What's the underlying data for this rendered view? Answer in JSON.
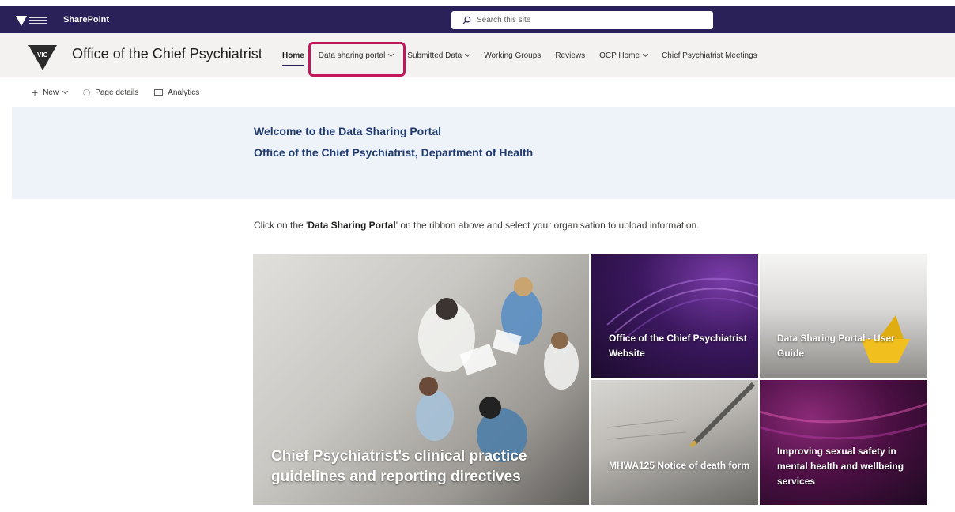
{
  "suite": {
    "app_name": "SharePoint",
    "search_placeholder": "Search this site"
  },
  "site": {
    "title": "Office of the Chief Psychiatrist"
  },
  "nav": [
    {
      "label": "Home",
      "dropdown": false
    },
    {
      "label": "Data sharing portal",
      "dropdown": true
    },
    {
      "label": "Submitted Data",
      "dropdown": true
    },
    {
      "label": "Working Groups",
      "dropdown": false
    },
    {
      "label": "Reviews",
      "dropdown": false
    },
    {
      "label": "OCP Home",
      "dropdown": true
    },
    {
      "label": "Chief Psychiatrist Meetings",
      "dropdown": false
    }
  ],
  "commandbar": {
    "new_label": "New",
    "page_details_label": "Page details",
    "analytics_label": "Analytics"
  },
  "hero": {
    "line1": "Welcome to the Data Sharing Portal",
    "line2": "Office of the Chief Psychiatrist, Department of Health"
  },
  "instruction": {
    "before": "Click on the '",
    "bold": "Data Sharing Portal",
    "after": "' on the ribbon above and select your organisation to upload information."
  },
  "tiles": {
    "big": "Chief Psychiatrist's clinical practice guidelines and reporting directives",
    "t1": "Office of the Chief Psychiatrist Website",
    "t2": "Data Sharing Portal - User Guide",
    "t3": "MHWA125 Notice of death form",
    "t4": "Improving sexual safety in mental health and wellbeing services"
  },
  "colors": {
    "suitebar": "#2b2159",
    "highlight": "#c2185b",
    "hero_text": "#1e3a6e"
  }
}
